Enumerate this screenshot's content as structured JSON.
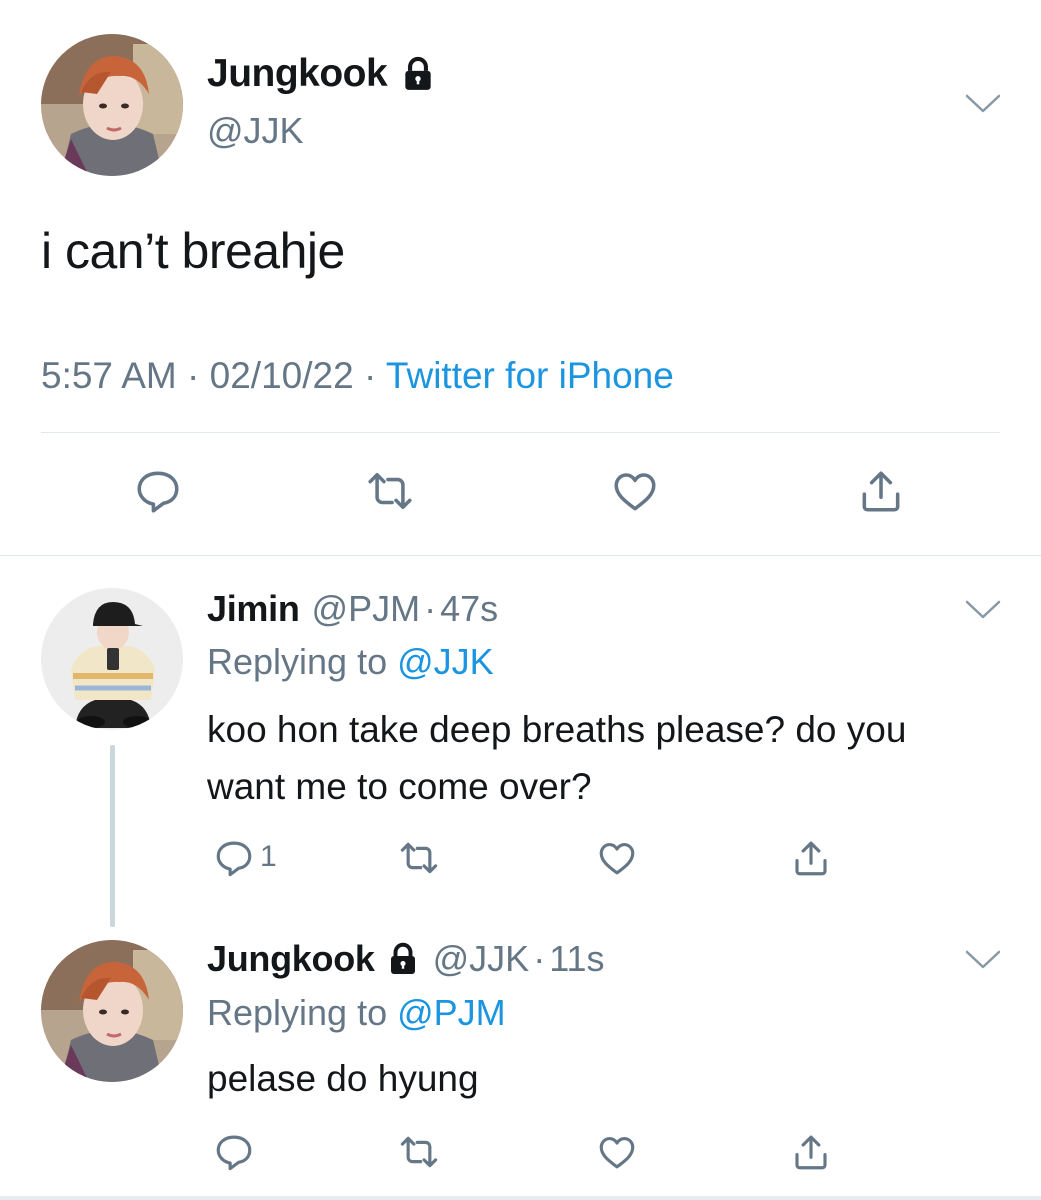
{
  "main_tweet": {
    "author_name": "Jungkook",
    "handle": "@JJK",
    "text": "i can’t breahje",
    "time": "5:57 AM",
    "separator": "·",
    "date": "02/10/22",
    "source": "Twitter for iPhone",
    "icons": [
      "lock-icon",
      "chevron-down-icon",
      "reply-icon",
      "retweet-icon",
      "like-icon",
      "share-icon"
    ]
  },
  "replies": [
    {
      "author_name": "Jimin",
      "handle": "@PJM",
      "separator": "·",
      "time": "47s",
      "replying_prefix": "Replying to",
      "replying_to": "@JJK",
      "text": "koo hon take deep breaths please? do you want me to come over?",
      "reply_count": "1"
    },
    {
      "author_name": "Jungkook",
      "handle": "@JJK",
      "separator": "·",
      "time": "11s",
      "replying_prefix": "Replying to",
      "replying_to": "@PJM",
      "text": "pelase do hyung",
      "reply_count": ""
    }
  ],
  "colors": {
    "text": "#14171a",
    "secondary": "#657786",
    "link": "#1b95e0",
    "divider": "#e1e8ed",
    "thread_line": "#ccd6dd"
  }
}
